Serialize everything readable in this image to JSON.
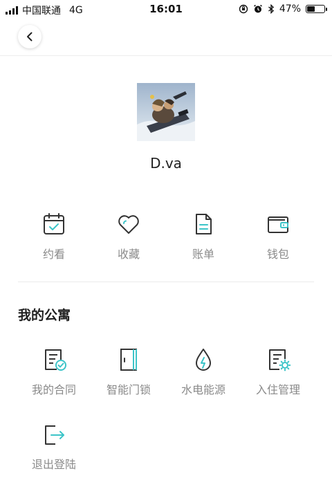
{
  "status_bar": {
    "carrier": "中国联通",
    "network": "4G",
    "time": "16:01",
    "battery": "47%",
    "battery_level": 0.47
  },
  "profile": {
    "username": "D.va"
  },
  "quick_actions": [
    {
      "label": "约看",
      "icon": "calendar-check-icon"
    },
    {
      "label": "收藏",
      "icon": "heart-icon"
    },
    {
      "label": "账单",
      "icon": "bill-icon"
    },
    {
      "label": "钱包",
      "icon": "wallet-icon"
    }
  ],
  "apartment": {
    "title": "我的公寓",
    "items": [
      {
        "label": "我的合同",
        "icon": "contract-check-icon"
      },
      {
        "label": "智能门锁",
        "icon": "door-icon"
      },
      {
        "label": "水电能源",
        "icon": "water-bolt-icon"
      },
      {
        "label": "入住管理",
        "icon": "document-gear-icon"
      },
      {
        "label": "退出登陆",
        "icon": "logout-icon"
      }
    ]
  },
  "colors": {
    "accent": "#3cc4c8",
    "icon_stroke": "#333333",
    "label": "#8a8a8a"
  }
}
